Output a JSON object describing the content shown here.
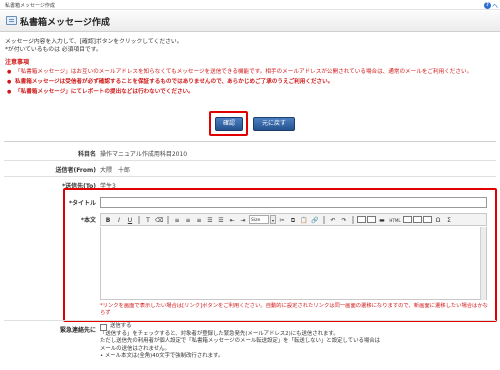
{
  "topbar": {
    "crumb": "私書箱メッセージ作成",
    "help": "ヘ"
  },
  "titlebar": {
    "title": "私書箱メッセージ作成"
  },
  "intro": {
    "line1": "メッセージ内容を入力して、[確認]ボタンをクリックしてください。",
    "line2": "*が付いているものは 必須項目です。"
  },
  "notes": {
    "heading": "注意事項",
    "items": [
      "「私書箱メッセージ」はお互いのメールアドレスを知らなくてもメッセージを送信できる機能です。相手のメールアドレスが公開されている場合は、通常のメールをご利用ください。",
      "私書箱メッセージは受信者が必ず確認することを保証するものではありませんので、あらかじめご了承のうえご利用ください。",
      "「私書箱メッセージ」にてレポートの提出などは行わないでください。"
    ]
  },
  "buttons": {
    "confirm": "確認",
    "back": "元に戻す"
  },
  "form": {
    "subject_label": "科目名",
    "subject_value": "操作マニュアル作成用科目2010",
    "sender_label": "送信者(From)",
    "sender_value": "大隈　十郎",
    "recipient_label": "*送信先(To)",
    "recipient_value": "学生3",
    "title_label": "*タイトル",
    "body_label": "*本文",
    "toolbar": {
      "bold": "B",
      "italic": "I",
      "underline": "U",
      "font_size": "Size",
      "font_size_arrow": "▾",
      "special_char": "Ω",
      "html": "HTML",
      "sum": "Σ"
    },
    "editor_note": "*リンクを画面で表示したい場合は[リンク]ボタンをご利用ください。自動的に設定されたリンクは同一画面の遷移になりますので、新画面に遷移したい場合はかならず",
    "urgent_label": "緊急連絡先に",
    "urgent_check": "送信する",
    "urgent_desc": [
      "「送信する」をチェックすると、対象者が登録した緊急発先(メールアドレス2)にも送信されます。",
      "ただし送信先の利用者が個人設定で「私書箱メッセージのメール転送設定」を「転送しない」と設定している場合は",
      "メールの送信はされません。",
      "• メール本文は(全角)40文字で強制改行されます。"
    ]
  }
}
